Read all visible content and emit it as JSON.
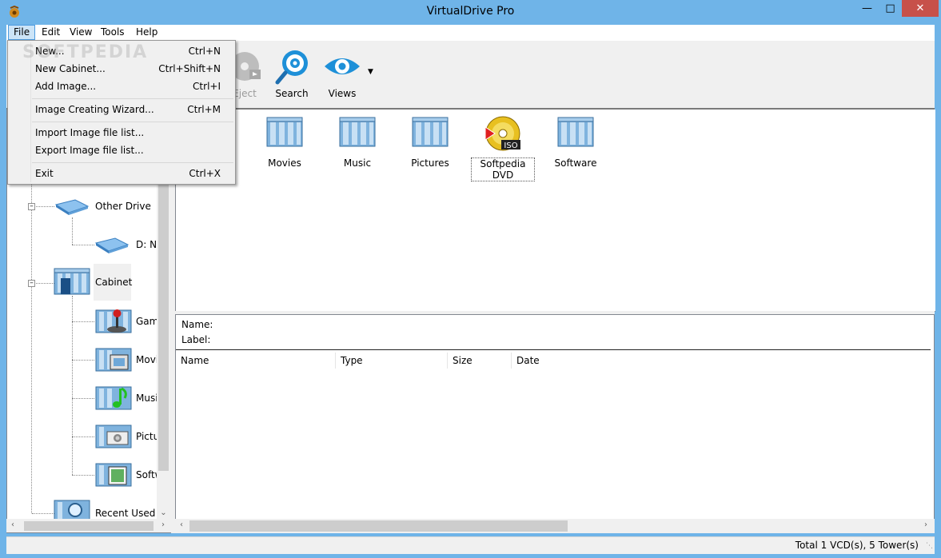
{
  "window": {
    "title": "VirtualDrive Pro"
  },
  "menubar": [
    "File",
    "Edit",
    "View",
    "Tools",
    "Help"
  ],
  "file_menu": {
    "groups": [
      [
        {
          "label": "New...",
          "shortcut": "Ctrl+N"
        },
        {
          "label": "New Cabinet...",
          "shortcut": "Ctrl+Shift+N"
        },
        {
          "label": "Add Image...",
          "shortcut": "Ctrl+I"
        }
      ],
      [
        {
          "label": "Image Creating Wizard...",
          "shortcut": "Ctrl+M"
        }
      ],
      [
        {
          "label": "Import Image file list...",
          "shortcut": ""
        },
        {
          "label": "Export Image file list...",
          "shortcut": ""
        }
      ],
      [
        {
          "label": "Exit",
          "shortcut": "Ctrl+X"
        }
      ]
    ]
  },
  "toolbar": {
    "eject_label": "Eject",
    "search_label": "Search",
    "views_label": "Views"
  },
  "tree": {
    "other_drive": "Other Drive",
    "d_drive": "D: No",
    "cabinet": "Cabinet",
    "children": [
      "Games",
      "Movies",
      "Music",
      "Pictures",
      "Software"
    ],
    "recent_used": "Recent Used"
  },
  "icon_view": [
    {
      "label": "Movies",
      "icon": "cabinet-icon"
    },
    {
      "label": "Music",
      "icon": "cabinet-icon"
    },
    {
      "label": "Pictures",
      "icon": "cabinet-icon"
    },
    {
      "label": "Softpedia DVD",
      "icon": "iso-disc-icon"
    },
    {
      "label": "Software",
      "icon": "cabinet-icon"
    }
  ],
  "details": {
    "name_label": "Name:",
    "label_label": "Label:"
  },
  "columns": [
    "Name",
    "Type",
    "Size",
    "Date"
  ],
  "status": {
    "text": "Total 1 VCD(s), 5 Tower(s)"
  },
  "watermark": "SOFTPEDIA"
}
